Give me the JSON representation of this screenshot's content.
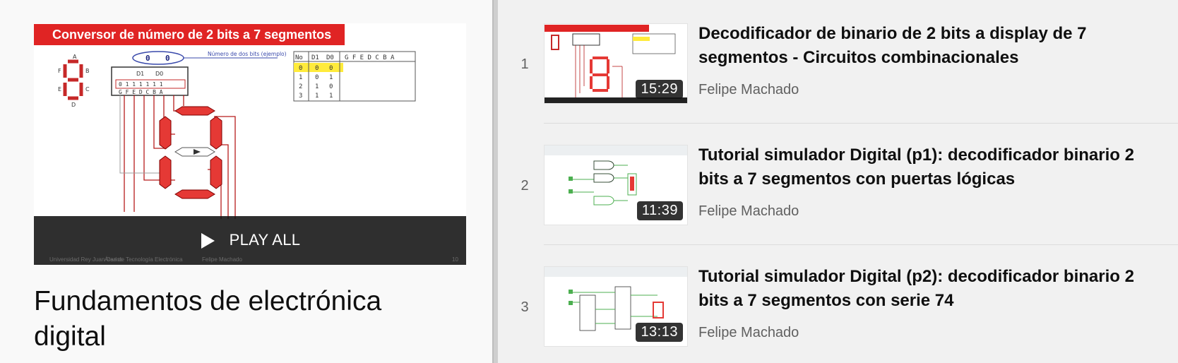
{
  "playlist": {
    "hero_banner": "Conversor de número de 2 bits a 7 segmentos",
    "play_all_label": "PLAY ALL",
    "title": "Fundamentos de electrónica digital",
    "hero_table": {
      "headers": [
        "No",
        "D1",
        "D0",
        "G F E D C B A"
      ],
      "rows": [
        [
          "0",
          "0",
          "0"
        ],
        [
          "1",
          "0",
          "1"
        ],
        [
          "2",
          "1",
          "0"
        ],
        [
          "3",
          "1",
          "1"
        ]
      ]
    },
    "hero_note": "Número de dos bits (ejemplo)",
    "hero_bits": [
      "0",
      "0"
    ],
    "hero_d_labels": [
      "D1",
      "D0"
    ],
    "hero_outputs": "0 1 1 1 1 1 1",
    "hero_out_labels": "G F E D C B A",
    "hero_footer": [
      "Universidad Rey Juan Carlos",
      "Área de Tecnología Electrónica",
      "Felipe Machado",
      "10"
    ]
  },
  "videos": [
    {
      "index": "1",
      "title": "Decodificador de binario de 2 bits a display de 7 segmentos - Circuitos combinacionales",
      "channel": "Felipe Machado",
      "duration": "15:29"
    },
    {
      "index": "2",
      "title": "Tutorial simulador Digital (p1): decodificador binario 2 bits a 7 segmentos con puertas lógicas",
      "channel": "Felipe Machado",
      "duration": "11:39"
    },
    {
      "index": "3",
      "title": "Tutorial simulador Digital (p2): decodificador binario 2 bits a 7 segmentos con serie 74",
      "channel": "Felipe Machado",
      "duration": "13:13"
    }
  ],
  "colors": {
    "banner_red": "#e02424",
    "segment_red": "#e53935",
    "wire_green": "#4caf50"
  }
}
